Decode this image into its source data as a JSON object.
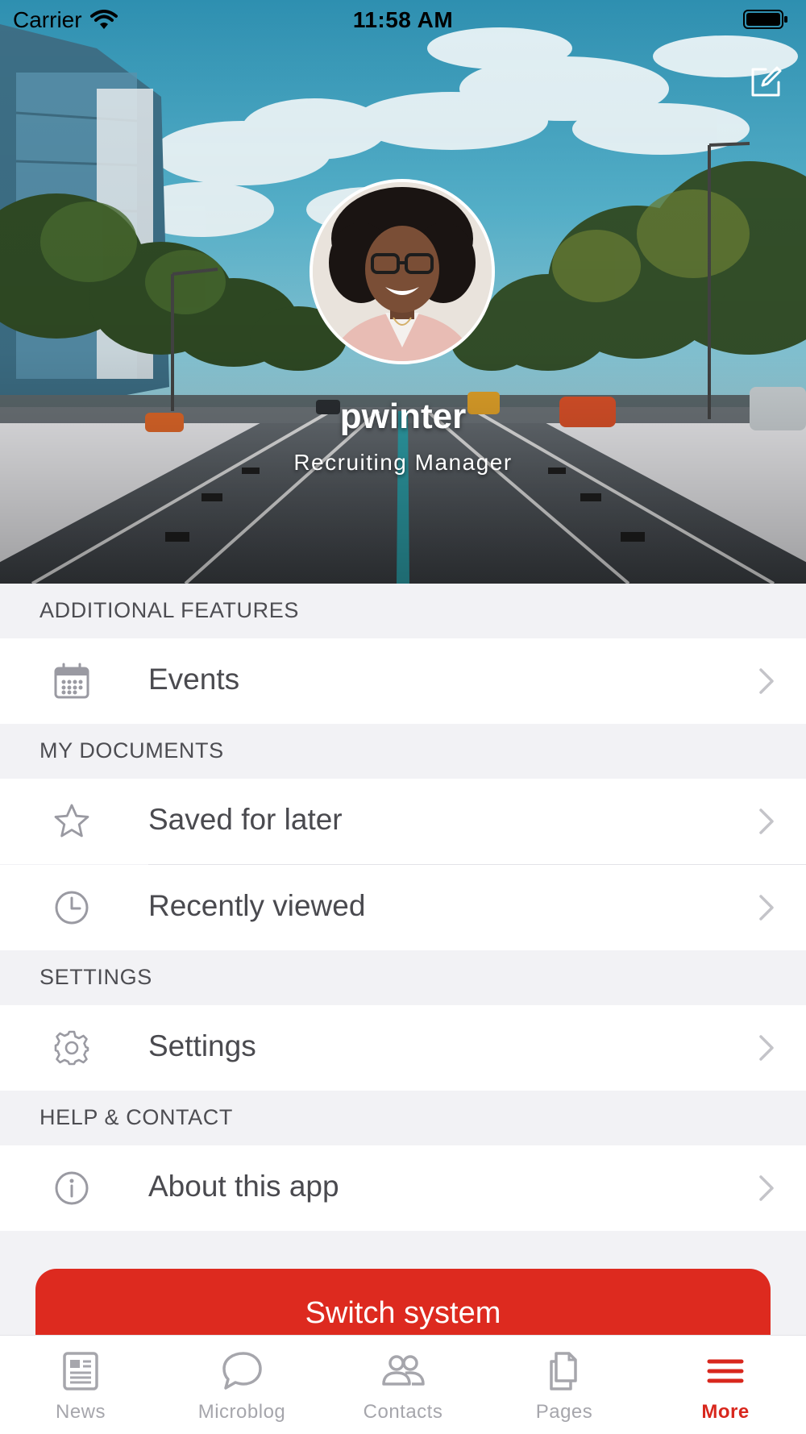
{
  "status_bar": {
    "carrier": "Carrier",
    "time": "11:58 AM"
  },
  "profile": {
    "username": "pwinter",
    "job_title": "Recruiting Manager"
  },
  "sections": [
    {
      "header": "ADDITIONAL FEATURES",
      "items": [
        {
          "label": "Events",
          "icon": "calendar-icon"
        }
      ]
    },
    {
      "header": "MY DOCUMENTS",
      "items": [
        {
          "label": "Saved for later",
          "icon": "star-icon"
        },
        {
          "label": "Recently viewed",
          "icon": "clock-icon"
        }
      ]
    },
    {
      "header": "SETTINGS",
      "items": [
        {
          "label": "Settings",
          "icon": "gear-icon"
        }
      ]
    },
    {
      "header": "HELP & CONTACT",
      "items": [
        {
          "label": "About this app",
          "icon": "info-icon"
        }
      ]
    }
  ],
  "switch_button": {
    "label": "Switch system"
  },
  "tab_bar": {
    "tabs": [
      {
        "label": "News",
        "icon": "newspaper-icon",
        "active": false
      },
      {
        "label": "Microblog",
        "icon": "chat-bubble-icon",
        "active": false
      },
      {
        "label": "Contacts",
        "icon": "contacts-icon",
        "active": false
      },
      {
        "label": "Pages",
        "icon": "pages-icon",
        "active": false
      },
      {
        "label": "More",
        "icon": "menu-icon",
        "active": true
      }
    ]
  },
  "colors": {
    "accent": "#dd2a1f",
    "tab_active": "#d8271d",
    "tab_inactive": "#a6a6ac",
    "section_background": "#f2f2f5"
  }
}
